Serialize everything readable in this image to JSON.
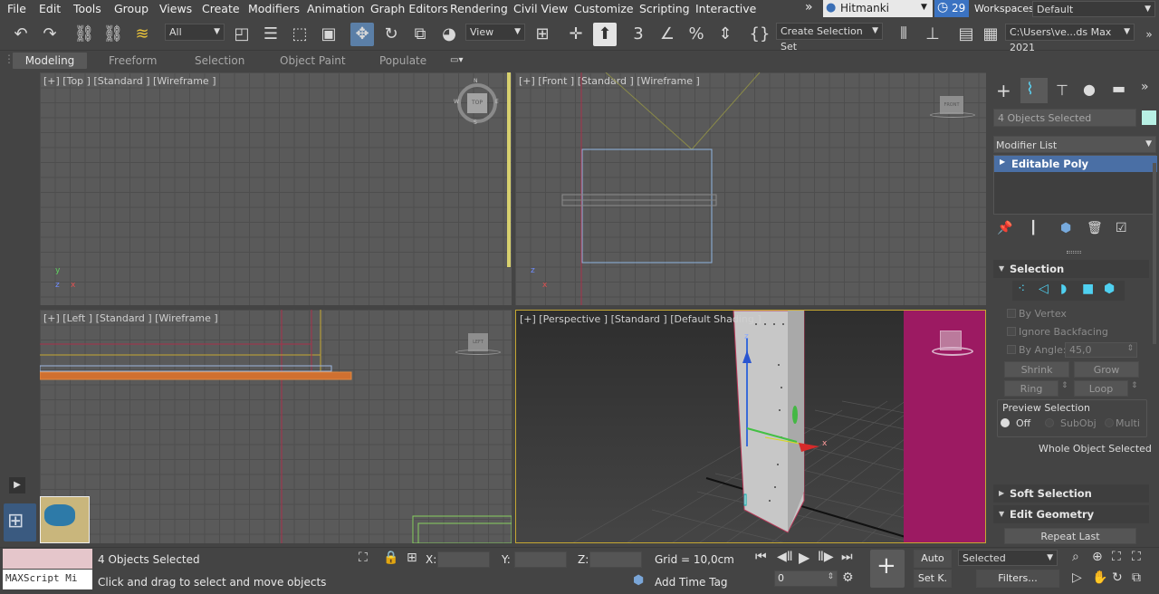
{
  "menu": [
    "File",
    "Edit",
    "Tools",
    "Group",
    "Views",
    "Create",
    "Modifiers",
    "Animation",
    "Graph Editors",
    "Rendering",
    "Civil View",
    "Customize",
    "Scripting",
    "Interactive"
  ],
  "menu_overflow": "»",
  "user": {
    "name": "Hitmanki",
    "notifications": "29"
  },
  "workspace": {
    "label": "Workspaces:",
    "value": "Default"
  },
  "toolbar": {
    "selection_filter": "All",
    "ref_coord": "View",
    "selection_set_placeholder": "Create Selection Set",
    "path": "C:\\Users\\ve...ds Max 2021"
  },
  "ribbon_tabs": [
    "Modeling",
    "Freeform",
    "Selection",
    "Object Paint",
    "Populate"
  ],
  "viewports": {
    "top": {
      "label": "[+] [Top ] [Standard ] [Wireframe ]",
      "cube": "TOP"
    },
    "front": {
      "label": "[+] [Front ] [Standard ] [Wireframe ]",
      "cube": "FRONT"
    },
    "left": {
      "label": "[+] [Left ] [Standard ] [Wireframe ]",
      "cube": "LEFT"
    },
    "persp": {
      "label": "[+] [Perspective ] [Standard ] [Default Shading ]"
    }
  },
  "axes": {
    "x": "x",
    "y": "y",
    "z": "z"
  },
  "cube_dirs": {
    "n": "N",
    "s": "S",
    "e": "E",
    "w": "W"
  },
  "command_panel": {
    "objects_selected": "4 Objects Selected",
    "modifier_list": "Modifier List",
    "stack_item": "Editable Poly",
    "selection": {
      "title": "Selection",
      "by_vertex": "By Vertex",
      "ignore_backfacing": "Ignore Backfacing",
      "by_angle": "By Angle:",
      "angle_value": "45,0",
      "shrink": "Shrink",
      "grow": "Grow",
      "ring": "Ring",
      "loop": "Loop",
      "preview_title": "Preview Selection",
      "preview_off": "Off",
      "preview_subobj": "SubObj",
      "preview_multi": "Multi",
      "status": "Whole Object Selected"
    },
    "soft_selection": "Soft Selection",
    "edit_geometry": "Edit Geometry",
    "repeat_last": "Repeat Last"
  },
  "status": {
    "script_label": "MAXScript Mi",
    "selected_text": "4 Objects Selected",
    "prompt": "Click and drag to select and move objects",
    "x_label": "X:",
    "y_label": "Y:",
    "z_label": "Z:",
    "grid": "Grid = 10,0cm",
    "add_time_tag": "Add Time Tag",
    "frame": "0",
    "auto": "Auto",
    "set_key": "Set K.",
    "key_filter_value": "Selected",
    "filters": "Filters..."
  },
  "colors": {
    "accent": "#5b7fa7",
    "selected_highlight": "#4a6fa5",
    "door": "#c8c8c8",
    "magenta": "#9c1a62",
    "persp_border": "#c6a832"
  }
}
